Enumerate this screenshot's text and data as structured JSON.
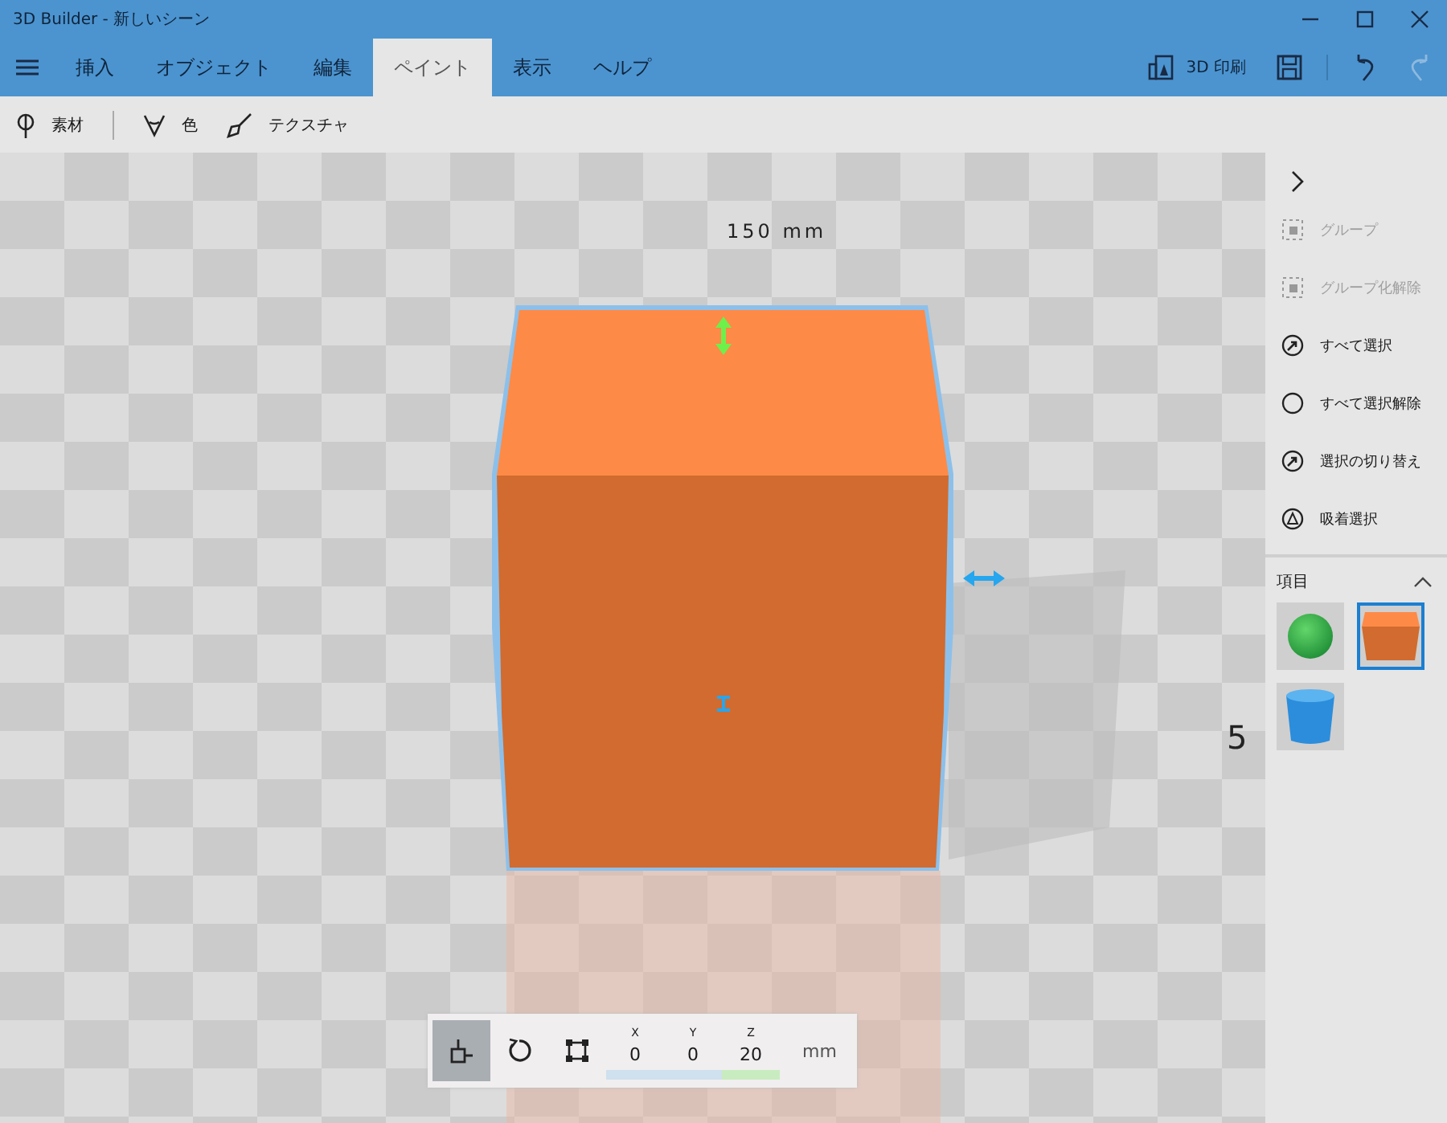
{
  "window": {
    "title": "3D Builder - 新しいシーン"
  },
  "tabs": [
    {
      "label": "挿入",
      "selected": false
    },
    {
      "label": "オブジェクト",
      "selected": false
    },
    {
      "label": "編集",
      "selected": false
    },
    {
      "label": "ペイント",
      "selected": true
    },
    {
      "label": "表示",
      "selected": false
    },
    {
      "label": "ヘルプ",
      "selected": false
    }
  ],
  "actions": {
    "print_label": "3D 印刷",
    "redo_disabled": true
  },
  "toolbar": [
    {
      "kind": "material",
      "label": "素材"
    },
    {
      "kind": "color",
      "label": "色"
    },
    {
      "kind": "texture",
      "label": "テクスチャ"
    }
  ],
  "viewport": {
    "top_label": "150 mm",
    "side_label": "5"
  },
  "side_panel": {
    "commands": [
      {
        "kind": "group",
        "label": "グループ",
        "disabled": true
      },
      {
        "kind": "ungroup",
        "label": "グループ化解除",
        "disabled": true
      },
      {
        "kind": "select-all",
        "label": "すべて選択",
        "disabled": false
      },
      {
        "kind": "deselect",
        "label": "すべて選択解除",
        "disabled": false
      },
      {
        "kind": "invert",
        "label": "選択の切り替え",
        "disabled": false
      },
      {
        "kind": "snap",
        "label": "吸着選択",
        "disabled": false
      }
    ],
    "items_title": "項目",
    "items_expanded": true,
    "objects": [
      {
        "kind": "sphere",
        "selected": false
      },
      {
        "kind": "cube",
        "selected": true
      },
      {
        "kind": "cylinder",
        "selected": false
      }
    ]
  },
  "transform": {
    "tools": [
      {
        "kind": "move",
        "selected": true
      },
      {
        "kind": "rotate",
        "selected": false
      },
      {
        "kind": "scale",
        "selected": false
      }
    ],
    "coords": [
      {
        "axis": "X",
        "value": "0"
      },
      {
        "axis": "Y",
        "value": "0"
      },
      {
        "axis": "Z",
        "value": "20"
      }
    ],
    "unit": "mm"
  }
}
